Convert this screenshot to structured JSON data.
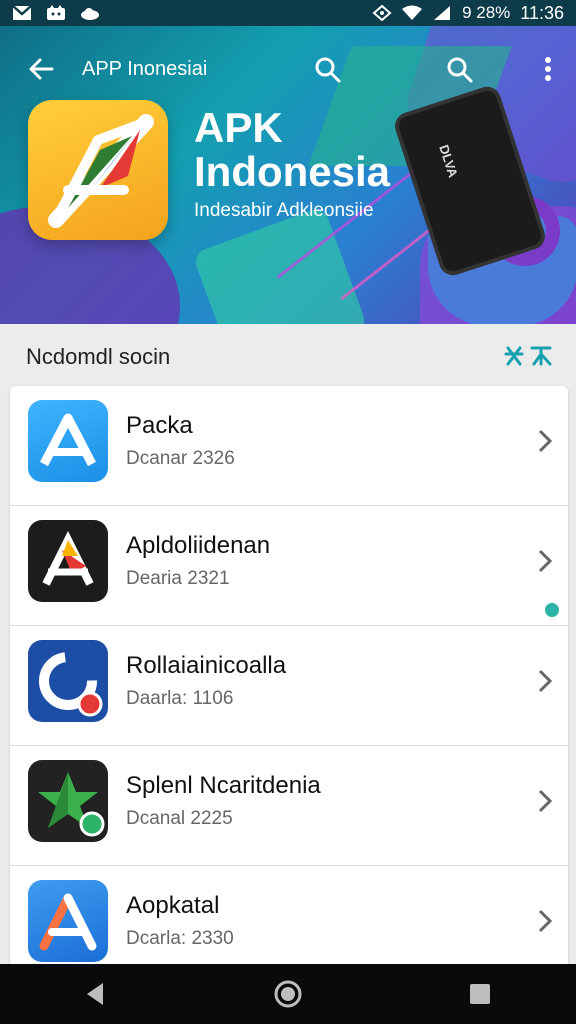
{
  "status_bar": {
    "battery_text": "9 28%",
    "time": "11:36",
    "icons": [
      "gmail-icon",
      "cat-icon",
      "cloud-icon",
      "vpn-icon",
      "wifi-icon",
      "signal-icon"
    ]
  },
  "app_bar": {
    "title": "APP Inonesiai",
    "icons": [
      "back-arrow-icon",
      "search-icon",
      "search-icon",
      "more-vert-icon"
    ]
  },
  "hero": {
    "title_line1": "APK",
    "title_line2": "Indonesia",
    "subtitle": "Indesabir Adkleonsiie",
    "phone_label": "DLVA"
  },
  "section": {
    "title": "Ncdomdl socin",
    "action_icons": [
      "tools-icon",
      "translate-icon"
    ]
  },
  "apps": [
    {
      "name": "Packa",
      "meta": "Dcanar 2326",
      "icon": "apk-triangle-icon",
      "colors": [
        "#1ea0ee",
        "#7cd3ff"
      ]
    },
    {
      "name": "Apldoliidenan",
      "meta": "Dearia 2321",
      "icon": "apk-triangle-icon",
      "colors": [
        "#1b1b1b",
        "#e53935"
      ]
    },
    {
      "name": "Rollaiainicoalla",
      "meta": "Daarla: 1106",
      "icon": "refresh-icon",
      "colors": [
        "#1d4ea6",
        "#ffffff"
      ]
    },
    {
      "name": "Splenl Ncaritdenia",
      "meta": "Dcanal 2225",
      "icon": "star-icon",
      "colors": [
        "#212121",
        "#35b24a"
      ]
    },
    {
      "name": "Aopkatal",
      "meta": "Dcarla: 2330",
      "icon": "apk-triangle-icon",
      "colors": [
        "#1e7fe0",
        "#ff7043"
      ]
    }
  ],
  "nav_bar": {
    "icons": [
      "back-triangle-icon",
      "home-circle-icon",
      "recents-square-icon"
    ]
  }
}
